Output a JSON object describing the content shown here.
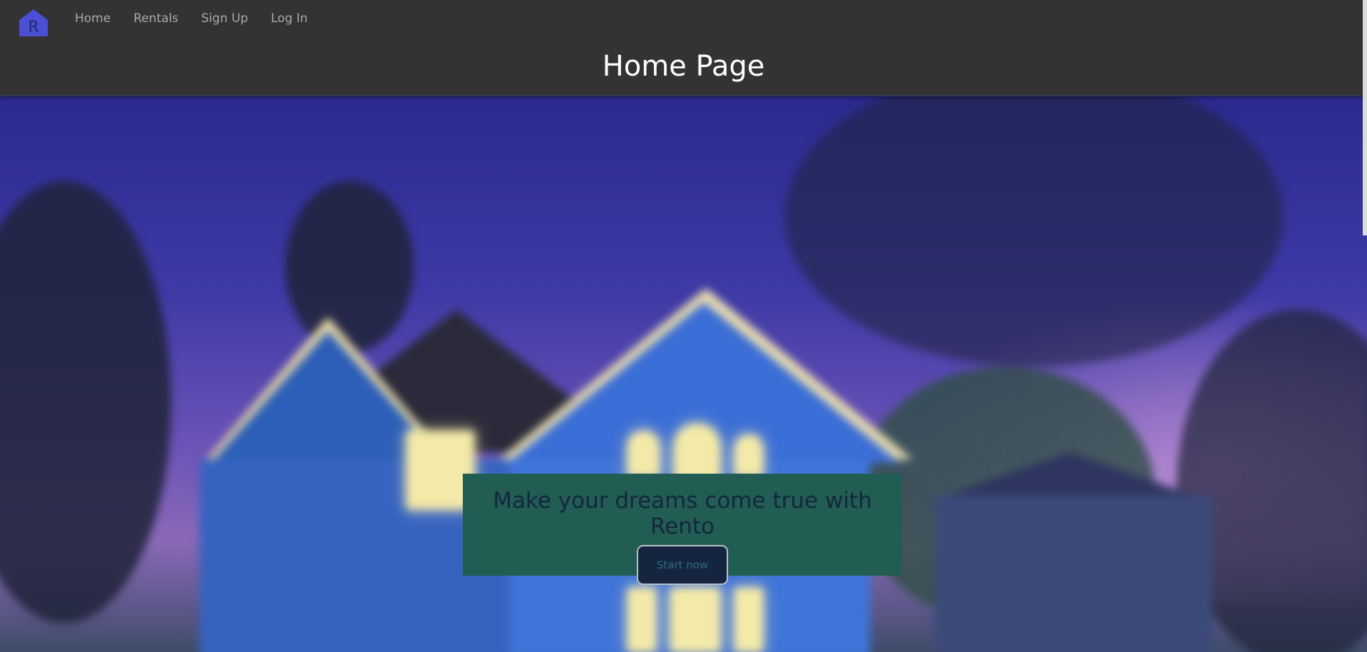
{
  "logo": {
    "letter": "R",
    "color": "#4a4fd4"
  },
  "nav": {
    "items": [
      {
        "label": "Home"
      },
      {
        "label": "Rentals"
      },
      {
        "label": "Sign Up"
      },
      {
        "label": "Log In"
      }
    ]
  },
  "header": {
    "title": "Home Page"
  },
  "hero": {
    "tagline": "Make your dreams come true with Rento",
    "button_label": "Start now"
  },
  "colors": {
    "topbar": "#333333",
    "cta_panel": "#215d53",
    "cta_button": "#15253f"
  }
}
